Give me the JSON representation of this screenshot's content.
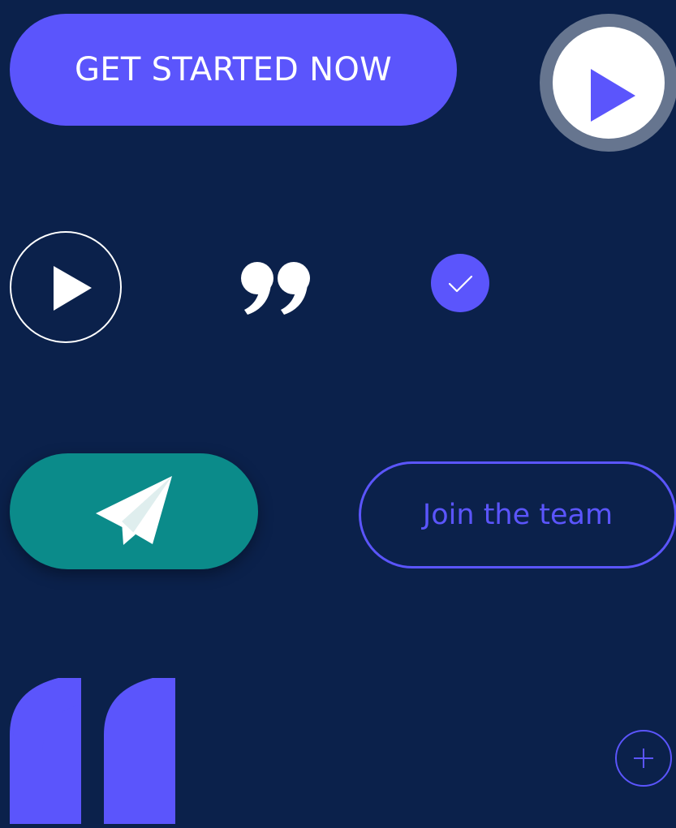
{
  "buttons": {
    "get_started_label": "GET STARTED NOW",
    "join_team_label": "Join the team"
  },
  "icons": {
    "play_large": "play-icon",
    "play_outline": "play-icon",
    "quote_close": "closing-quote-icon",
    "check": "check-icon",
    "send": "paper-plane-icon",
    "quote_open": "opening-quote-icon",
    "plus": "plus-icon"
  },
  "colors": {
    "background": "#0b214b",
    "accent": "#5b55fc",
    "teal": "#0b8b8a",
    "white": "#ffffff",
    "ring_gray": "#66758f"
  }
}
